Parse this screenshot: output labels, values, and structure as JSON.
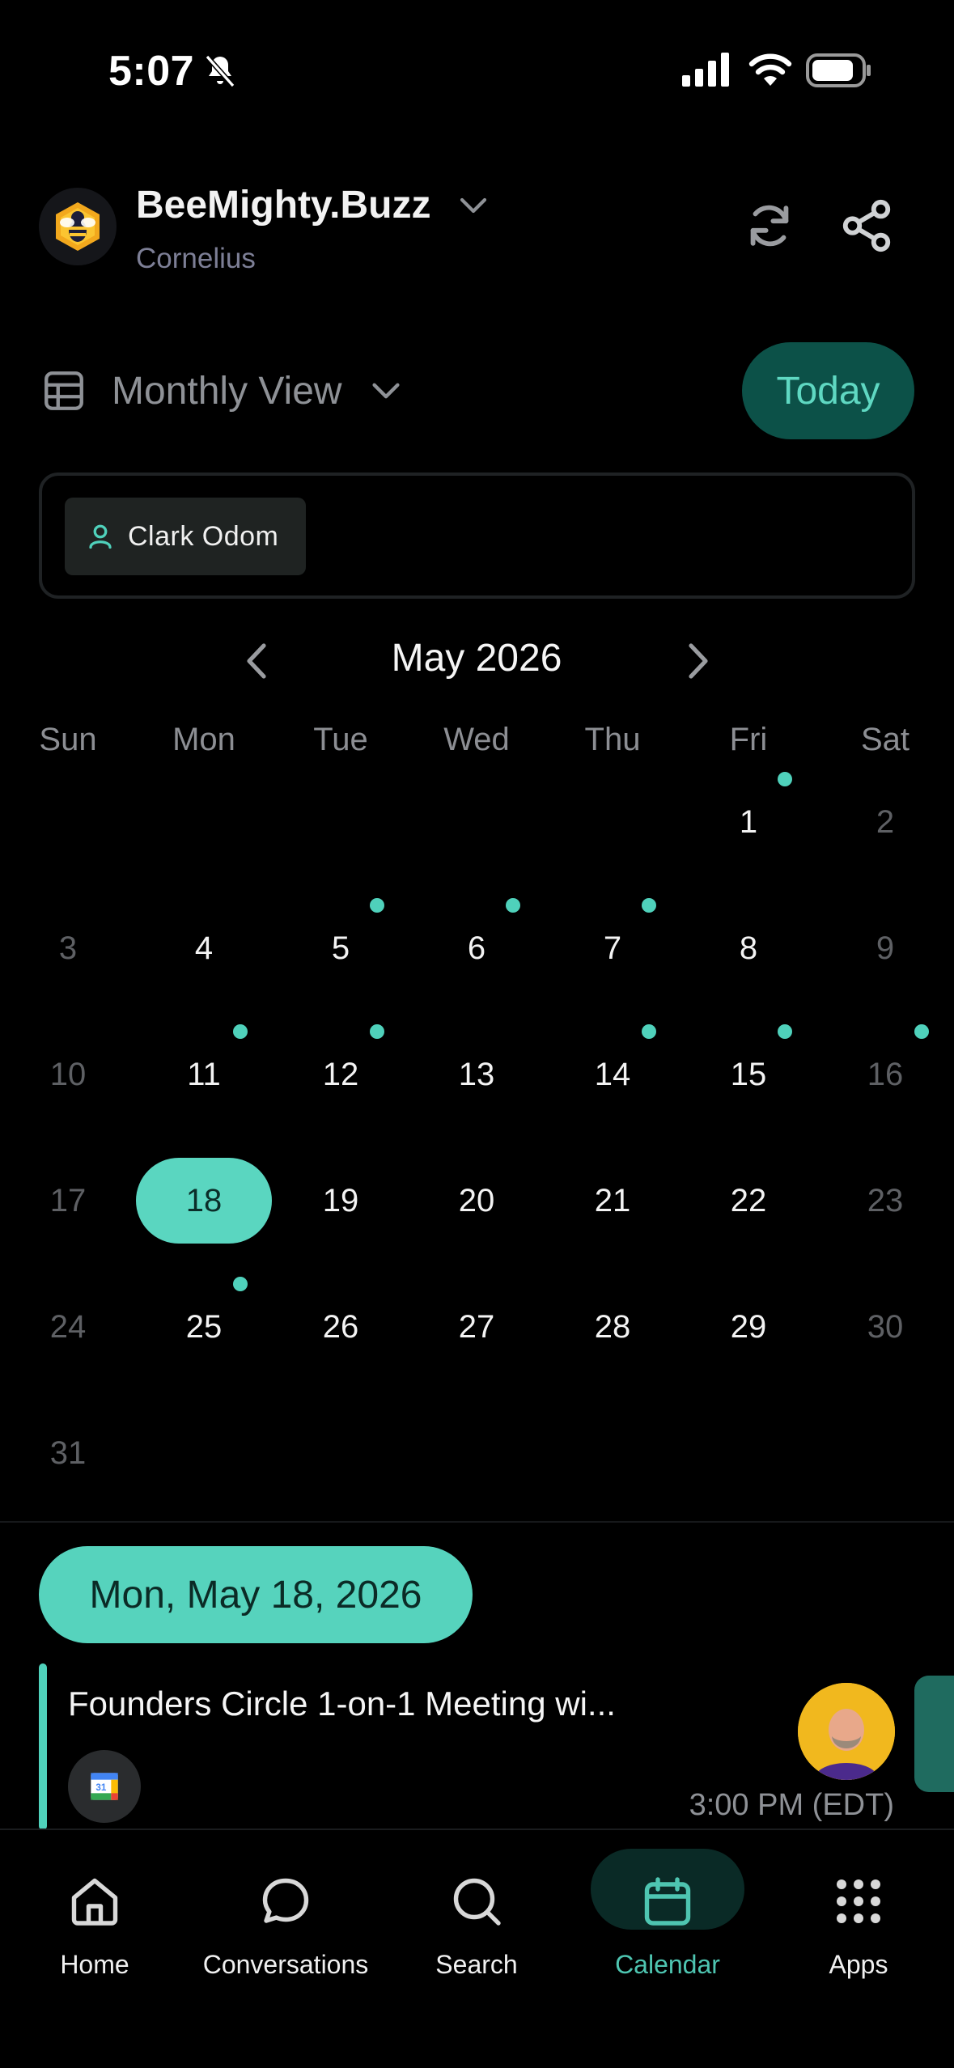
{
  "status_bar": {
    "time": "5:07"
  },
  "header": {
    "org_name": "BeeMighty.Buzz",
    "org_subtitle": "Cornelius"
  },
  "view": {
    "label": "Monthly View",
    "today_button": "Today"
  },
  "filter": {
    "chip_label": "Clark Odom"
  },
  "calendar": {
    "month_label": "May 2026",
    "weekdays": [
      "Sun",
      "Mon",
      "Tue",
      "Wed",
      "Thu",
      "Fri",
      "Sat"
    ],
    "selected_day": 18,
    "event_days": [
      1,
      5,
      6,
      7,
      11,
      12,
      14,
      15,
      16,
      25
    ],
    "days": [
      "1",
      "2",
      "3",
      "4",
      "5",
      "6",
      "7",
      "8",
      "9",
      "10",
      "11",
      "12",
      "13",
      "14",
      "15",
      "16",
      "17",
      "18",
      "19",
      "20",
      "21",
      "22",
      "23",
      "24",
      "25",
      "26",
      "27",
      "28",
      "29",
      "30",
      "31"
    ]
  },
  "selected_date_label": "Mon, May 18, 2026",
  "event": {
    "title": "Founders Circle 1-on-1 Meeting wi...",
    "time": "3:00 PM (EDT)"
  },
  "colors": {
    "accent": "#56d3bd",
    "today_bg": "#0c5148",
    "background": "#000000"
  },
  "bottom_nav": [
    {
      "label": "Home",
      "icon": "home-icon"
    },
    {
      "label": "Conversations",
      "icon": "chat-bubble-icon"
    },
    {
      "label": "Search",
      "icon": "search-icon"
    },
    {
      "label": "Calendar",
      "icon": "calendar-icon",
      "active": true
    },
    {
      "label": "Apps",
      "icon": "apps-grid-icon"
    }
  ]
}
